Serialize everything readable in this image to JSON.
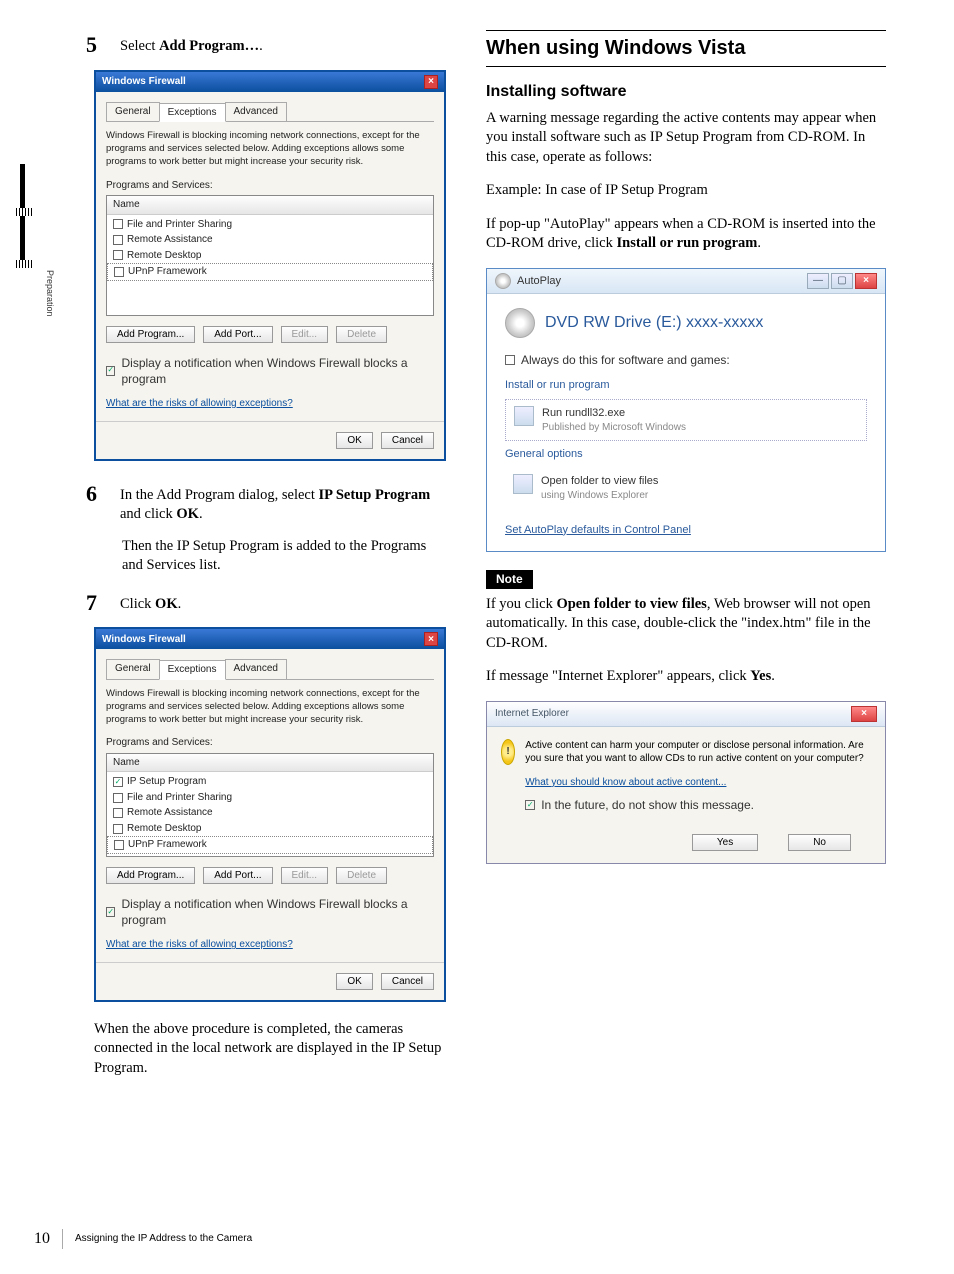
{
  "margin_label": "Preparation",
  "left": {
    "step5_num": "5",
    "step5_prefix": "Select ",
    "step5_bold": "Add Program…",
    "step5_suffix": ".",
    "step6_num": "6",
    "step6_a": "In the Add Program dialog, select ",
    "step6_b": "IP Setup Program",
    "step6_c": " and click ",
    "step6_d": "OK",
    "step6_e": ".",
    "step6_para": "Then the IP Setup Program is added to the Programs and Services list.",
    "step7_num": "7",
    "step7_a": "Click ",
    "step7_b": "OK",
    "step7_c": ".",
    "closing": "When the above procedure is completed, the cameras connected in the local network are displayed in the IP Setup Program."
  },
  "firewall": {
    "title": "Windows Firewall",
    "tabs": {
      "general": "General",
      "exceptions": "Exceptions",
      "advanced": "Advanced"
    },
    "desc": "Windows Firewall is blocking incoming network connections, except for the programs and services selected below. Adding exceptions allows some programs to work better but might increase your security risk.",
    "progserv": "Programs and Services:",
    "name": "Name",
    "items1": [
      "File and Printer Sharing",
      "Remote Assistance",
      "Remote Desktop",
      "UPnP Framework"
    ],
    "items2": [
      "IP Setup Program",
      "File and Printer Sharing",
      "Remote Assistance",
      "Remote Desktop",
      "UPnP Framework"
    ],
    "addprog": "Add Program...",
    "addport": "Add Port...",
    "edit": "Edit...",
    "delete": "Delete",
    "notify": "Display a notification when Windows Firewall blocks a program",
    "risks": "What are the risks of allowing exceptions?",
    "ok": "OK",
    "cancel": "Cancel"
  },
  "right": {
    "h2": "When using Windows Vista",
    "h3": "Installing software",
    "p1": "A warning message regarding the active contents may appear when you install software such as IP Setup Program from CD-ROM. In this case, operate as follows:",
    "p2": "Example: In case of IP Setup Program",
    "p3a": "If pop-up \"AutoPlay\" appears when a CD-ROM is inserted into the CD-ROM drive, click ",
    "p3b": "Install or run program",
    "p3c": ".",
    "note_label": "Note",
    "note_a": "If you click ",
    "note_b": "Open folder to view files",
    "note_c": ", Web browser will not open automatically. In this case, double-click the \"index.htm\" file in the CD-ROM.",
    "p4a": "If message \"Internet Explorer\" appears, click ",
    "p4b": "Yes",
    "p4c": "."
  },
  "autoplay": {
    "title": "AutoPlay",
    "drive": "DVD RW Drive (E:) xxxx-xxxxx",
    "always": "Always do this for software and games:",
    "grp1": "Install or run program",
    "run_main": "Run rundll32.exe",
    "run_sub": "Published by Microsoft Windows",
    "grp2": "General options",
    "open_main": "Open folder to view files",
    "open_sub": "using Windows Explorer",
    "cp_link": "Set AutoPlay defaults in Control Panel"
  },
  "ie": {
    "title": "Internet Explorer",
    "msg": "Active content can harm your computer or disclose personal information. Are you sure that you want to allow CDs to run active content on your computer?",
    "link": "What you should know about active content...",
    "future": "In the future, do not show this message.",
    "yes": "Yes",
    "no": "No"
  },
  "footer": {
    "page": "10",
    "text": "Assigning the IP Address to the Camera"
  }
}
